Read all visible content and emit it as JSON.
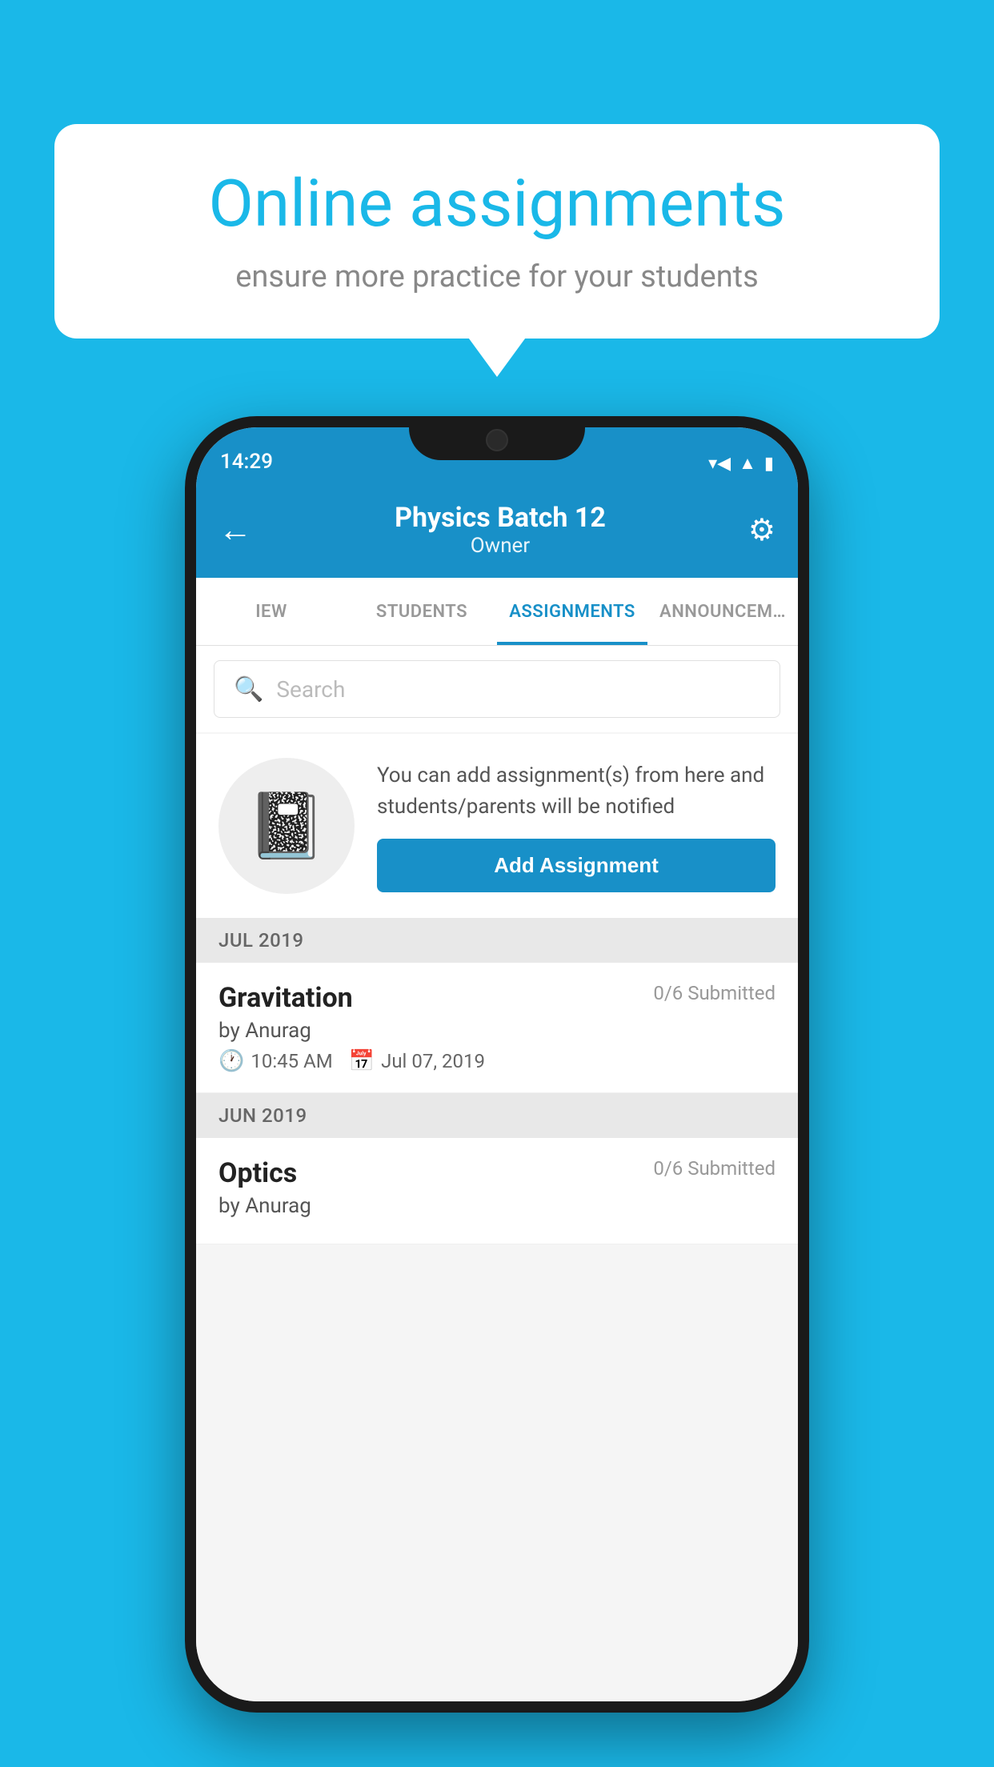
{
  "background": {
    "color": "#1ab8e8"
  },
  "speech_bubble": {
    "title": "Online assignments",
    "subtitle": "ensure more practice for your students"
  },
  "phone": {
    "status_bar": {
      "time": "14:29",
      "icons": [
        "wifi",
        "signal",
        "battery"
      ]
    },
    "app_bar": {
      "title": "Physics Batch 12",
      "subtitle": "Owner",
      "back_label": "←",
      "settings_label": "⚙"
    },
    "tabs": [
      {
        "label": "IEW",
        "active": false
      },
      {
        "label": "STUDENTS",
        "active": false
      },
      {
        "label": "ASSIGNMENTS",
        "active": true
      },
      {
        "label": "ANNOUNCEM…",
        "active": false
      }
    ],
    "search": {
      "placeholder": "Search"
    },
    "promo": {
      "description": "You can add assignment(s) from here and students/parents will be notified",
      "button_label": "Add Assignment"
    },
    "sections": [
      {
        "month": "JUL 2019",
        "assignments": [
          {
            "name": "Gravitation",
            "submitted": "0/6 Submitted",
            "by": "by Anurag",
            "time": "10:45 AM",
            "date": "Jul 07, 2019"
          }
        ]
      },
      {
        "month": "JUN 2019",
        "assignments": [
          {
            "name": "Optics",
            "submitted": "0/6 Submitted",
            "by": "by Anurag",
            "time": "",
            "date": ""
          }
        ]
      }
    ]
  }
}
